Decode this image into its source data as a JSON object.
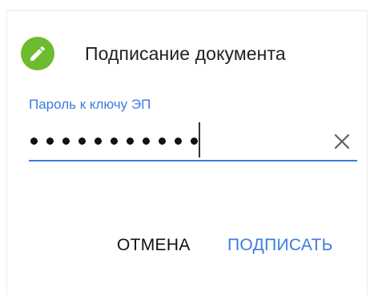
{
  "dialog": {
    "title": "Подписание документа",
    "icon": "pencil-icon",
    "icon_color": "#6dbb2e"
  },
  "password_field": {
    "label": "Пароль к ключу ЭП",
    "masked_length": 11,
    "clear_icon": "close-icon",
    "accent_color": "#3d7be0"
  },
  "actions": {
    "cancel_label": "ОТМЕНА",
    "sign_label": "ПОДПИСАТЬ",
    "primary_color": "#3d7be0"
  }
}
